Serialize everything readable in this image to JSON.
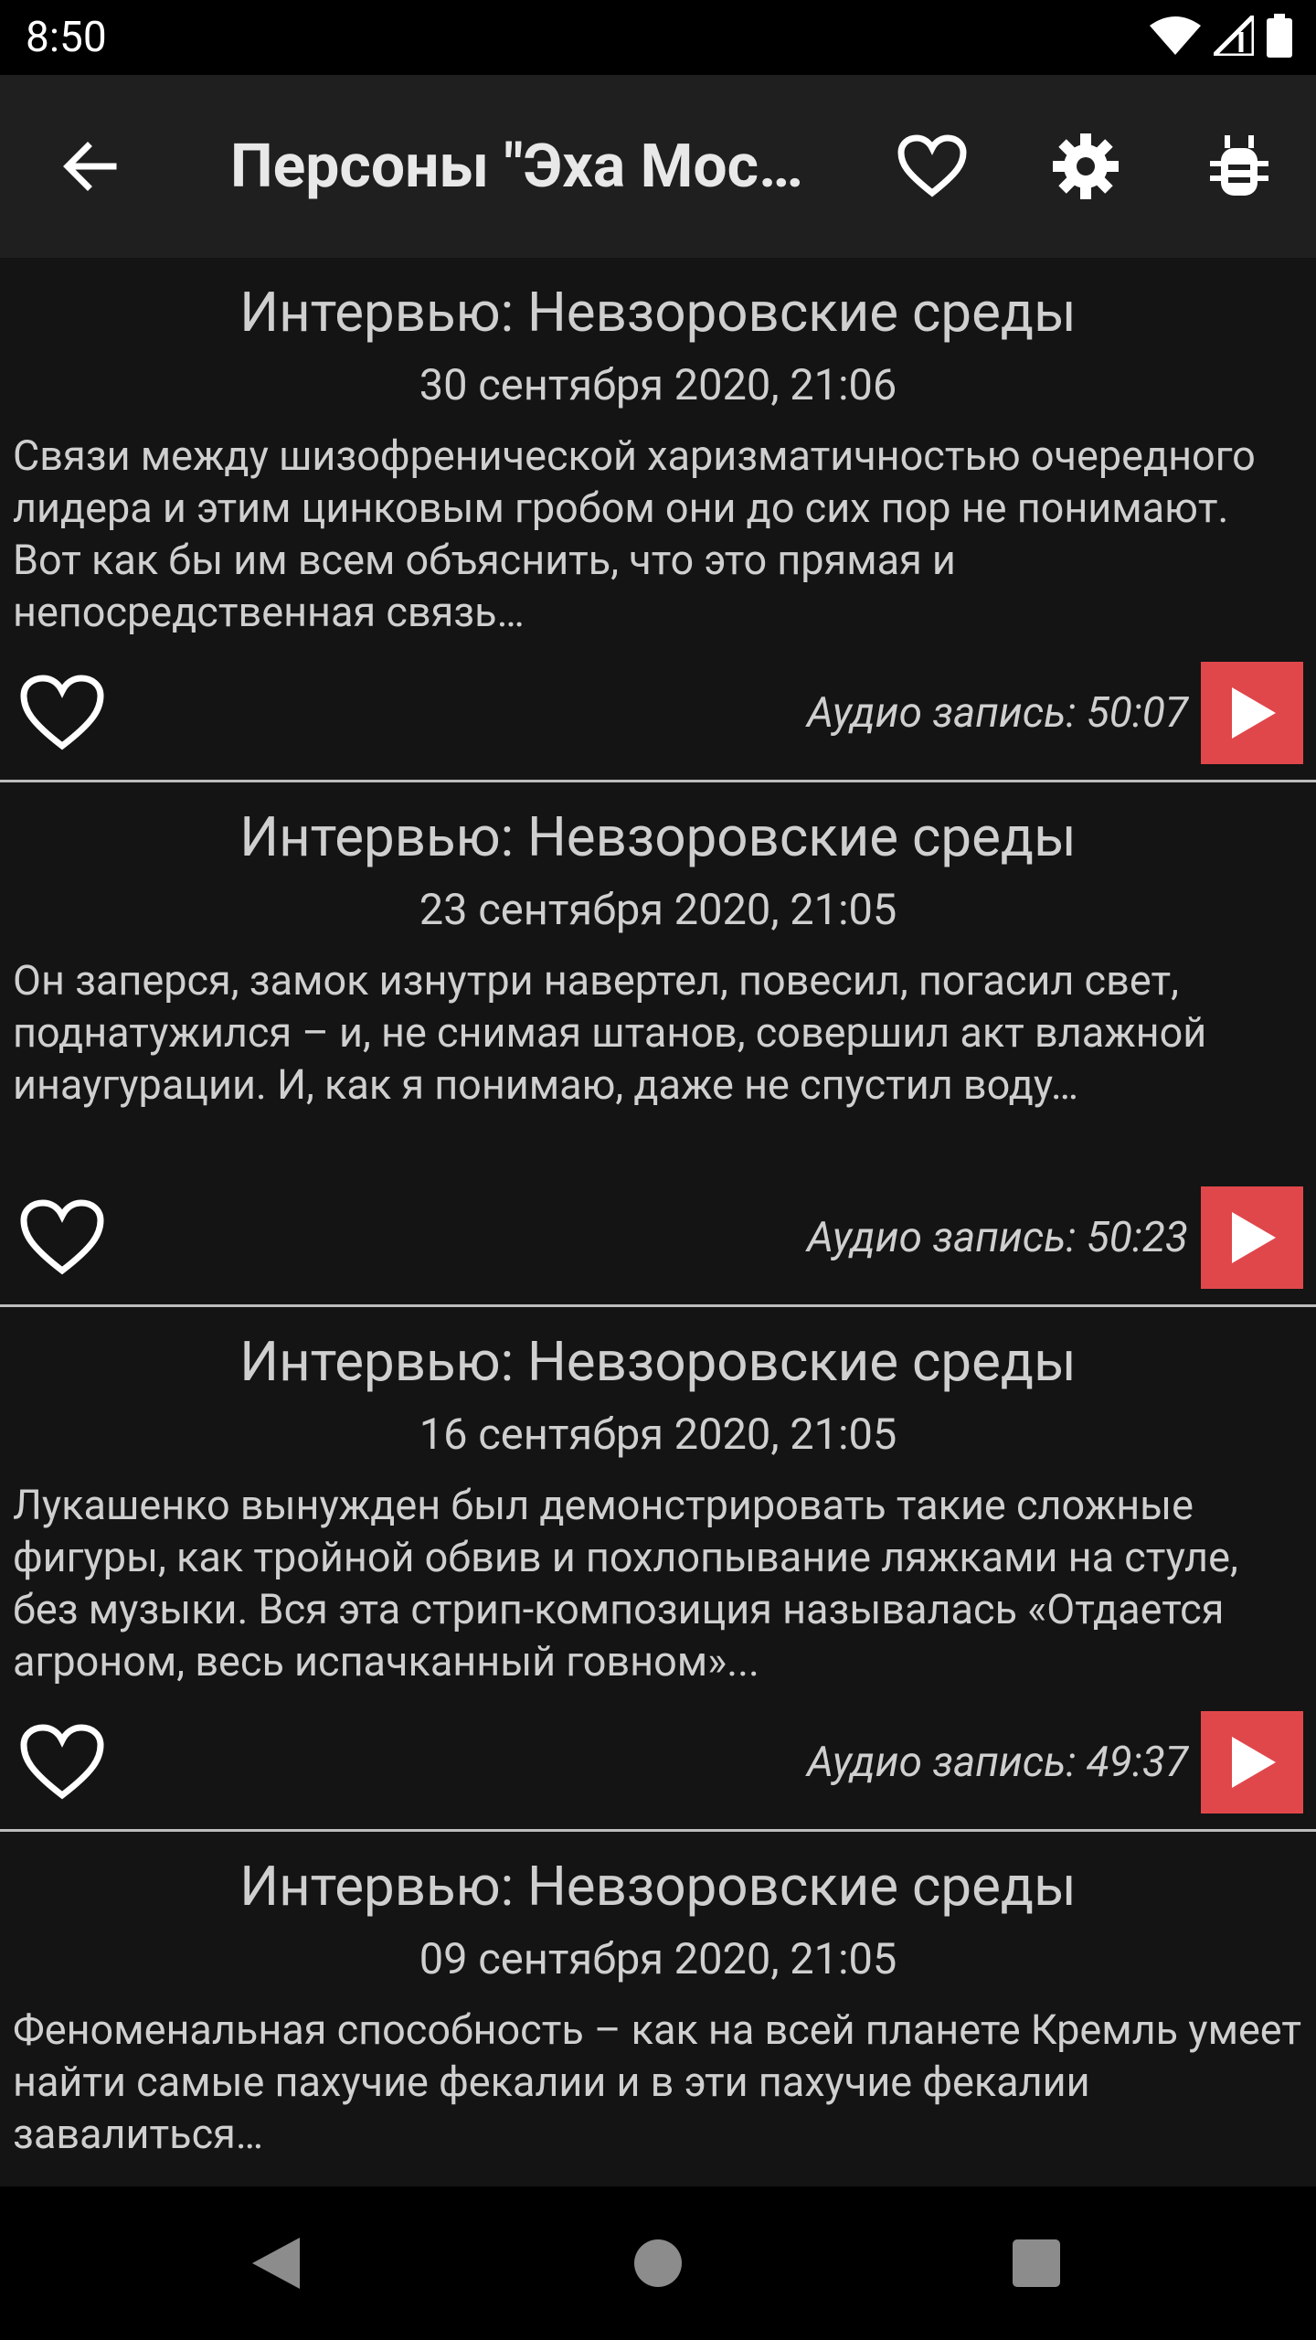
{
  "status_bar": {
    "time": "8:50",
    "icons": [
      "wifi-icon",
      "signal-icon",
      "battery-icon"
    ]
  },
  "app_bar": {
    "title": "Персоны \"Эха Москвы\"",
    "actions": [
      "back-arrow-icon",
      "heart-outline-icon",
      "gear-icon",
      "bug-icon"
    ]
  },
  "items": [
    {
      "title": "Интервью: Невзоровские среды",
      "date": "30 сентября 2020, 21:06",
      "description": "Связи между шизофренической харизматичностью очередного лидера и этим цинковым гробом они до сих пор не понимают. Вот как бы им всем объяснить, что это прямая и непосредственная связь…",
      "audio_label": "Аудио запись: 50:07"
    },
    {
      "title": "Интервью: Невзоровские среды",
      "date": "23 сентября 2020, 21:05",
      "description": "Он заперся, замок изнутри навертел, повесил, погасил свет, поднатужился – и, не снимая штанов, совершил акт влажной инаугурации. И, как я понимаю, даже не спустил воду…",
      "audio_label": "Аудио запись: 50:23"
    },
    {
      "title": "Интервью: Невзоровские среды",
      "date": "16 сентября 2020, 21:05",
      "description": "Лукашенко вынужден был демонстрировать такие сложные фигуры, как тройной обвив и похлопывание ляжками на стуле, без музыки. Вся эта стрип-композиция называлась «Отдается агроном, весь испачканный говном»...",
      "audio_label": "Аудио запись: 49:37"
    },
    {
      "title": "Интервью: Невзоровские среды",
      "date": "09 сентября 2020, 21:05",
      "description": "Феноменальная способность – как на всей планете Кремль умеет найти самые пахучие фекалии и в эти пахучие фекалии завалиться…",
      "audio_label": ""
    }
  ],
  "nav_bar": {
    "buttons": [
      "back-triangle-icon",
      "home-circle-icon",
      "recents-square-icon"
    ]
  },
  "colors": {
    "background": "#141414",
    "app_bar": "#1f1f1f",
    "accent_play": "#e0474b",
    "divider": "#bdbdbd"
  }
}
